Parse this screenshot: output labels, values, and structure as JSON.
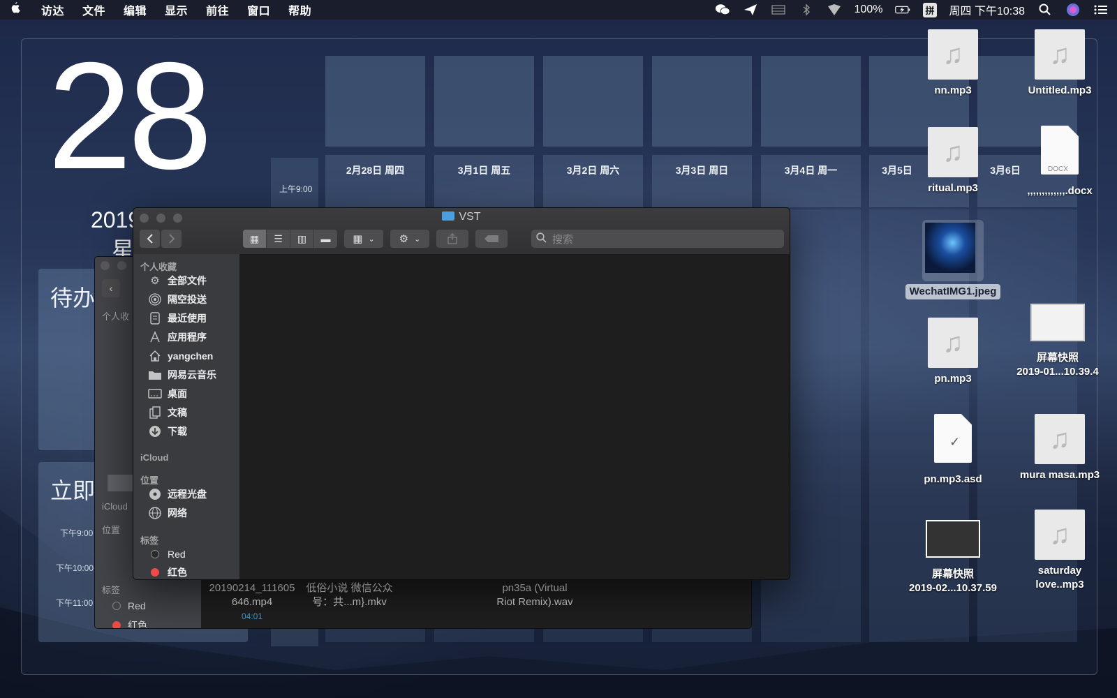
{
  "menubar": {
    "apple": "",
    "items": [
      "访达",
      "文件",
      "编辑",
      "显示",
      "前往",
      "窗口",
      "帮助"
    ],
    "battery": "100%",
    "input_method": "拼",
    "clock": "周四 下午10:38"
  },
  "today": {
    "day": "28",
    "year_month": "2019年2月",
    "weekday": "星",
    "todo_title": "待办",
    "now_title": "立即",
    "times": [
      "下午9:00",
      "下午10:00",
      "下午11:00"
    ]
  },
  "calendar": {
    "am_label": "上午9:00",
    "days": [
      "2月28日 周四",
      "3月1日 周五",
      "3月2日 周六",
      "3月3日 周日",
      "3月4日 周一",
      "3月5日",
      "3月6日"
    ]
  },
  "desktop": {
    "icons": [
      {
        "name": "nn.mp3"
      },
      {
        "name": "Untitled.mp3"
      },
      {
        "name": "ritual.mp3"
      },
      {
        "name": ",,,,,,,,,,,,,.docx",
        "badge": "DOCX"
      },
      {
        "name": "WechatIMG1.jpeg"
      },
      {
        "name": "屏幕快照\n2019-01...10.39.4"
      },
      {
        "name": "pn.mp3"
      },
      {
        "name": "pn.mp3.asd"
      },
      {
        "name": "mura masa.mp3"
      },
      {
        "name": "屏幕快照\n2019-02...10.37.59"
      },
      {
        "name": "saturday\nlove..mp3"
      }
    ]
  },
  "back_window": {
    "section_favorites": "个人收",
    "section_icloud": "iCloud",
    "section_locations": "位置",
    "section_tags": "标签",
    "tag_red_en": "Red",
    "tag_red_cn": "红色",
    "files": [
      {
        "name": "20190214_111605\n646.mp4",
        "meta": "04:01"
      },
      {
        "name": "低俗小说 微信公众\n号：共...m}.mkv"
      },
      {
        "name": "pn35a (Virtual\nRiot Remix).wav"
      }
    ]
  },
  "finder": {
    "title": "VST",
    "search_placeholder": "搜索",
    "sections": {
      "favorites": "个人收藏",
      "icloud": "iCloud",
      "locations": "位置",
      "tags": "标签"
    },
    "favorites": [
      {
        "label": "全部文件",
        "icon": "gear-icon"
      },
      {
        "label": "隔空投送",
        "icon": "airdrop-icon"
      },
      {
        "label": "最近使用",
        "icon": "recents-icon"
      },
      {
        "label": "应用程序",
        "icon": "applications-icon"
      },
      {
        "label": "yangchen",
        "icon": "home-icon"
      },
      {
        "label": "网易云音乐",
        "icon": "folder-icon"
      },
      {
        "label": "桌面",
        "icon": "desktop-icon"
      },
      {
        "label": "文稿",
        "icon": "documents-icon"
      },
      {
        "label": "下载",
        "icon": "download-icon"
      }
    ],
    "locations": [
      {
        "label": "远程光盘",
        "icon": "disc-icon"
      },
      {
        "label": "网络",
        "icon": "network-icon"
      }
    ],
    "tags": [
      {
        "label": "Red",
        "color": "#2a2a2a"
      },
      {
        "label": "红色",
        "color": "#f04a4a"
      }
    ]
  }
}
